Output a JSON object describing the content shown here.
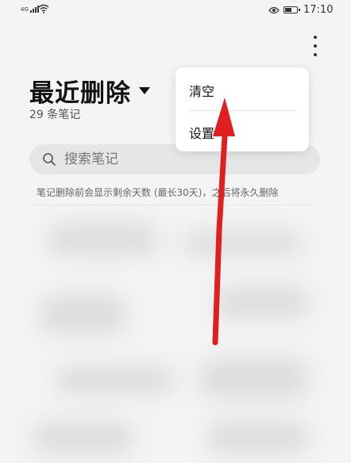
{
  "status_bar": {
    "signal_label": "4G",
    "time": "17:10",
    "battery_level": 0.6
  },
  "header": {
    "title": "最近删除",
    "note_count": "29 条笔记"
  },
  "search": {
    "placeholder": "搜索笔记"
  },
  "info_text": "笔记删除前会显示剩余天数 (最长30天)，之后将永久删除",
  "menu": {
    "items": [
      {
        "label": "清空"
      },
      {
        "label": "设置"
      }
    ]
  },
  "annotation": {
    "color": "#e02020"
  }
}
